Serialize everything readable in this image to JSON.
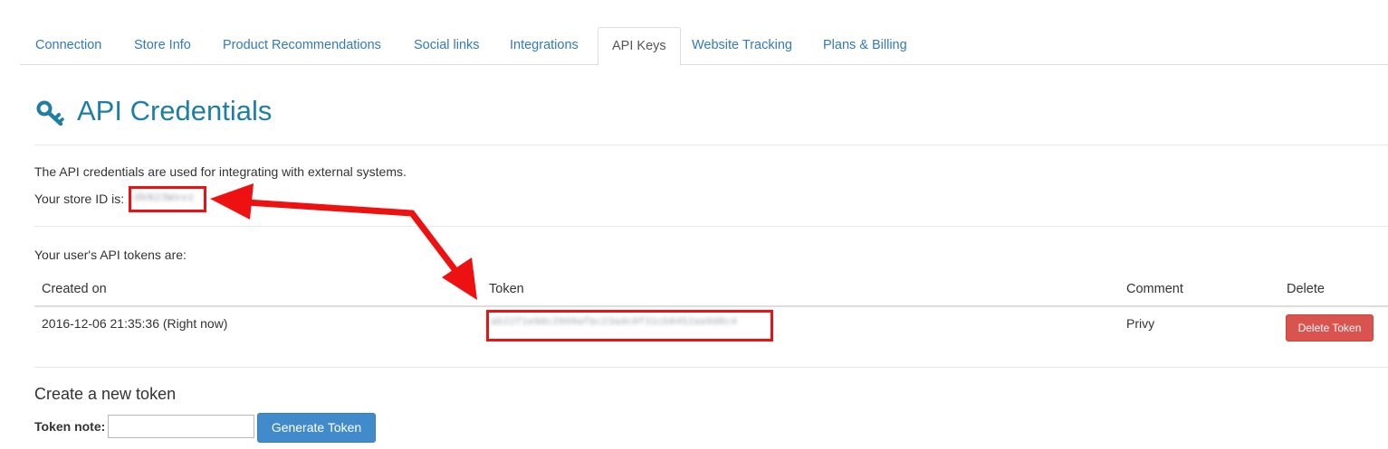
{
  "tabs": [
    {
      "label": "Connection"
    },
    {
      "label": "Store Info"
    },
    {
      "label": "Product Recommendations"
    },
    {
      "label": "Social links"
    },
    {
      "label": "Integrations"
    },
    {
      "label": "API Keys",
      "active": true
    },
    {
      "label": "Website Tracking"
    },
    {
      "label": "Plans & Billing"
    }
  ],
  "heading": {
    "title": "API Credentials",
    "icon": "key-icon"
  },
  "credentials": {
    "description": "The API credentials are used for integrating with external systems.",
    "store_id_label": "Your store ID is:",
    "store_id_value": "dkN23Wxvz",
    "tokens_label": "Your user's API tokens are:"
  },
  "table": {
    "headers": [
      "Created on",
      "Token",
      "Comment",
      "Delete"
    ],
    "rows": [
      {
        "created_on": "2016-12-06 21:35:36 (Right now)",
        "token": "ab22f1e9dc2809afbc23adc9f31cb8452ae0d8c4",
        "comment": "Privy",
        "delete_label": "Delete Token"
      }
    ]
  },
  "create_token": {
    "title": "Create a new token",
    "note_label": "Token note:",
    "note_value": "",
    "button_label": "Generate Token"
  },
  "colors": {
    "link": "#337ab7",
    "heading": "#1f7ea6",
    "danger": "#d9534f",
    "primary": "#428bca",
    "annotation": "#ee1111"
  }
}
